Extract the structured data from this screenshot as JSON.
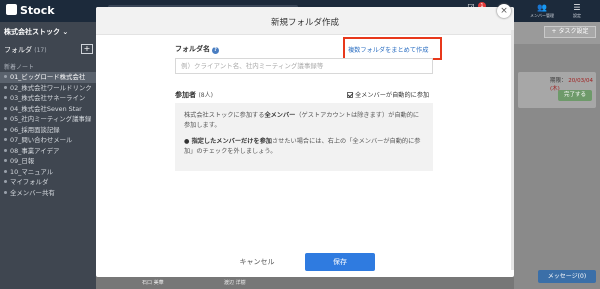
{
  "app": {
    "logo": "Stock",
    "topbar": {
      "notification_count": "1",
      "members_label": "メンバー管理",
      "settings_label": "設定"
    }
  },
  "sidebar": {
    "company": "株式会社ストック ⌄",
    "folders_label": "フォルダ",
    "folders_count": "(17)",
    "add_label": "+",
    "section_label": "新着ノート",
    "items": [
      "01_ビッグロード株式会社",
      "02_株式会社ワールドリンク",
      "03_株式会社サネーライン",
      "04_株式会社Seven Star",
      "05_社内ミーティング議事録",
      "06_採用面談記録",
      "07_問い合わせメール",
      "08_事業アイデア",
      "09_日報",
      "10_マニュアル",
      "マイフォルダ",
      "全メンバー共有"
    ]
  },
  "rightpanel": {
    "task_button": "+ タスク設定",
    "due_label": "期限：",
    "due_date": "20/03/04 (木)",
    "done_button": "完了する",
    "message_button": "メッセージ(0)"
  },
  "bottom": {
    "name1": "石口 美華",
    "name2": "渡辺 洋樹"
  },
  "modal": {
    "title": "新規フォルダ作成",
    "close": "×",
    "folder_name_label": "フォルダ名",
    "help_icon": "?",
    "bulk_create_link": "複数フォルダをまとめて作成",
    "folder_name_placeholder": "例）クライアント名、社内ミーティング議事録等",
    "participants_label": "参加者",
    "participants_count": "(8人)",
    "auto_join_label": "全メンバーが自動的に参加",
    "info_p1_pre": "株式会社ストックに参加する",
    "info_p1_bold": "全メンバー",
    "info_p1_post": "（ゲストアカウントは除きます）が自動的に参加します。",
    "info_p2_bold": "指定したメンバーだけを参加",
    "info_p2_post": "させたい場合には、右上の「全メンバーが自動的に参加」のチェックを外しましょう。",
    "cancel_button": "キャンセル",
    "save_button": "保存"
  }
}
